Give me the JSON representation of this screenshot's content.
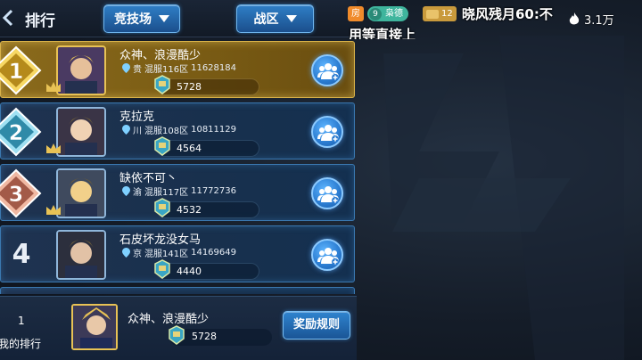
{
  "header": {
    "title": "排行",
    "mode_dropdown": "竞技场",
    "zone_dropdown": "战区"
  },
  "overlay": {
    "room_tag": "房",
    "fan_level": "9",
    "fan_name": "枭德",
    "user_level": "12",
    "message_line1": "晓风残月60:不",
    "message_line2": "用等直接上",
    "heat": "3.1万"
  },
  "rankings": [
    {
      "rank": "1",
      "name": "众神、浪漫酷少",
      "region": "贵",
      "server": "混服116区",
      "uid": "11628184",
      "score": "5728",
      "highlight": true
    },
    {
      "rank": "2",
      "name": "克拉克",
      "region": "川",
      "server": "混服108区",
      "uid": "10811129",
      "score": "4564",
      "highlight": false
    },
    {
      "rank": "3",
      "name": "缺依不可丶",
      "region": "渝",
      "server": "混服117区",
      "uid": "11772736",
      "score": "4532",
      "highlight": false
    },
    {
      "rank": "4",
      "name": "石皮坏龙没女马",
      "region": "京",
      "server": "混服141区",
      "uid": "14169649",
      "score": "4440",
      "highlight": false
    }
  ],
  "my_rank": {
    "rank": "1",
    "label": "我的排行",
    "name": "众神、浪漫酷少",
    "score": "5728",
    "reward_button": "奖励规则"
  },
  "colors": {
    "gold_row": "#8a6a1c",
    "blue_row": "#1f3350",
    "button_blue": "#2f7fc7"
  }
}
